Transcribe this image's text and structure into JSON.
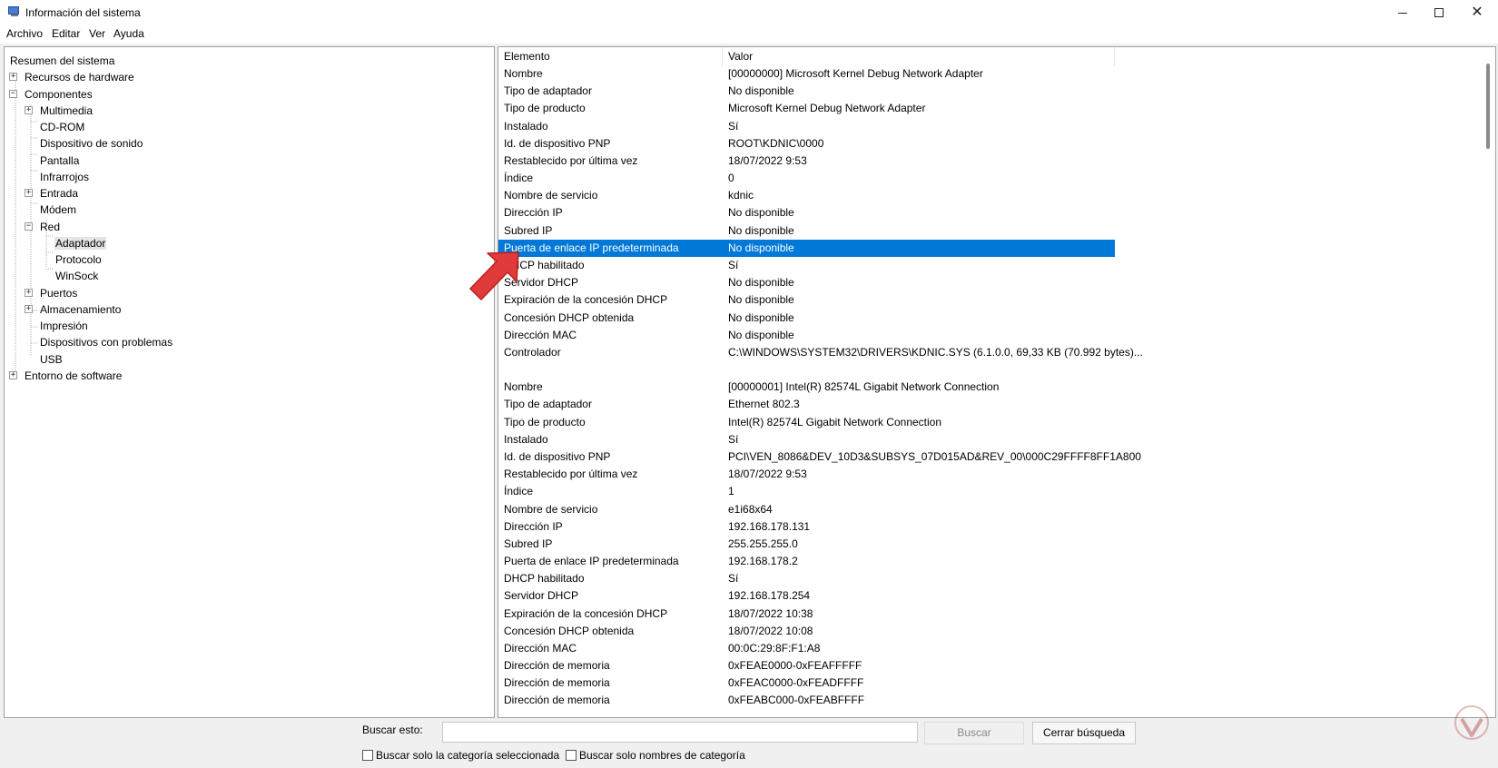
{
  "window": {
    "title": "Información del sistema"
  },
  "menu": [
    "Archivo",
    "Editar",
    "Ver",
    "Ayuda"
  ],
  "tree": [
    {
      "label": "Resumen del sistema",
      "level": 0,
      "expander": ""
    },
    {
      "label": "Recursos de hardware",
      "level": 1,
      "expander": "+"
    },
    {
      "label": "Componentes",
      "level": 1,
      "expander": "−"
    },
    {
      "label": "Multimedia",
      "level": 2,
      "expander": "+"
    },
    {
      "label": "CD-ROM",
      "level": 2,
      "expander": ""
    },
    {
      "label": "Dispositivo de sonido",
      "level": 2,
      "expander": ""
    },
    {
      "label": "Pantalla",
      "level": 2,
      "expander": ""
    },
    {
      "label": "Infrarrojos",
      "level": 2,
      "expander": ""
    },
    {
      "label": "Entrada",
      "level": 2,
      "expander": "+"
    },
    {
      "label": "Módem",
      "level": 2,
      "expander": ""
    },
    {
      "label": "Red",
      "level": 2,
      "expander": "−"
    },
    {
      "label": "Adaptador",
      "level": 3,
      "expander": "",
      "selected": true
    },
    {
      "label": "Protocolo",
      "level": 3,
      "expander": ""
    },
    {
      "label": "WinSock",
      "level": 3,
      "expander": ""
    },
    {
      "label": "Puertos",
      "level": 2,
      "expander": "+"
    },
    {
      "label": "Almacenamiento",
      "level": 2,
      "expander": "+"
    },
    {
      "label": "Impresión",
      "level": 2,
      "expander": ""
    },
    {
      "label": "Dispositivos con problemas",
      "level": 2,
      "expander": ""
    },
    {
      "label": "USB",
      "level": 2,
      "expander": ""
    },
    {
      "label": "Entorno de software",
      "level": 1,
      "expander": "+"
    }
  ],
  "list": {
    "headers": [
      "Elemento",
      "Valor"
    ],
    "rows": [
      [
        "Nombre",
        "[00000000] Microsoft Kernel Debug Network Adapter"
      ],
      [
        "Tipo de adaptador",
        "No disponible"
      ],
      [
        "Tipo de producto",
        "Microsoft Kernel Debug Network Adapter"
      ],
      [
        "Instalado",
        "Sí"
      ],
      [
        "Id. de dispositivo PNP",
        "ROOT\\KDNIC\\0000"
      ],
      [
        "Restablecido por última vez",
        "18/07/2022 9:53"
      ],
      [
        "Índice",
        "0"
      ],
      [
        "Nombre de servicio",
        "kdnic"
      ],
      [
        "Dirección IP",
        "No disponible"
      ],
      [
        "Subred IP",
        "No disponible"
      ],
      [
        "Puerta de enlace IP predeterminada",
        "No disponible"
      ],
      [
        "DHCP habilitado",
        "Sí"
      ],
      [
        "Servidor DHCP",
        "No disponible"
      ],
      [
        "Expiración de la concesión DHCP",
        "No disponible"
      ],
      [
        "Concesión DHCP obtenida",
        "No disponible"
      ],
      [
        "Dirección MAC",
        "No disponible"
      ],
      [
        "Controlador",
        "C:\\WINDOWS\\SYSTEM32\\DRIVERS\\KDNIC.SYS (6.1.0.0, 69,33 KB (70.992 bytes)..."
      ],
      [
        "",
        ""
      ],
      [
        "Nombre",
        "[00000001] Intel(R) 82574L Gigabit Network Connection"
      ],
      [
        "Tipo de adaptador",
        "Ethernet 802.3"
      ],
      [
        "Tipo de producto",
        "Intel(R) 82574L Gigabit Network Connection"
      ],
      [
        "Instalado",
        "Sí"
      ],
      [
        "Id. de dispositivo PNP",
        "PCI\\VEN_8086&DEV_10D3&SUBSYS_07D015AD&REV_00\\000C29FFFF8FF1A800"
      ],
      [
        "Restablecido por última vez",
        "18/07/2022 9:53"
      ],
      [
        "Índice",
        "1"
      ],
      [
        "Nombre de servicio",
        "e1i68x64"
      ],
      [
        "Dirección IP",
        "192.168.178.131"
      ],
      [
        "Subred IP",
        "255.255.255.0"
      ],
      [
        "Puerta de enlace IP predeterminada",
        "192.168.178.2"
      ],
      [
        "DHCP habilitado",
        "Sí"
      ],
      [
        "Servidor DHCP",
        "192.168.178.254"
      ],
      [
        "Expiración de la concesión DHCP",
        "18/07/2022 10:38"
      ],
      [
        "Concesión DHCP obtenida",
        "18/07/2022 10:08"
      ],
      [
        "Dirección MAC",
        "00:0C:29:8F:F1:A8"
      ],
      [
        "Dirección de memoria",
        "0xFEAE0000-0xFEAFFFFF"
      ],
      [
        "Dirección de memoria",
        "0xFEAC0000-0xFEADFFFF"
      ],
      [
        "Dirección de memoria",
        "0xFEABC000-0xFEABFFFF"
      ]
    ],
    "selected_row": 10
  },
  "search": {
    "label": "Buscar esto:",
    "value": "",
    "buscar_button": "Buscar",
    "cerrar_button": "Cerrar búsqueda",
    "check1": "Buscar solo la categoría seleccionada",
    "check2": "Buscar solo nombres de categoría"
  },
  "colors": {
    "selection": "#0078d7",
    "annotation_arrow": "#e03a3a"
  }
}
